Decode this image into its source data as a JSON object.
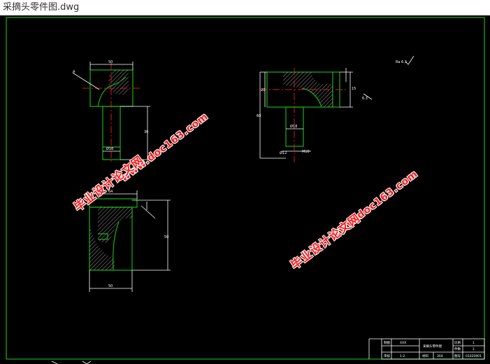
{
  "window": {
    "title": "采摘头零件图.dwg"
  },
  "drawing": {
    "colors": {
      "background": "#000000",
      "outline": "#18b218",
      "centerline": "#d01c1c",
      "dimension": "#ffffff",
      "watermark": "#ff1a1a"
    },
    "roughness_mark": "Ra 6.3"
  },
  "watermarks": [
    {
      "url": "www.doc163.com",
      "cn": "毕业设计论文网"
    },
    {
      "url": "www.doc163.com",
      "cn": "毕业设计论文网"
    }
  ],
  "title_block": {
    "r1c1": "制图",
    "r1c2": "XXX",
    "r1c3": "采摘头零件图",
    "r1c4": "比例",
    "r1c5": "1",
    "r2c4": "件数",
    "r2c5": "1",
    "r3c1": "审核",
    "r3c2": "1:2",
    "r3c3": "材料",
    "r3c3v": "304",
    "r3c4": "图号",
    "r3c5": "01020901"
  }
}
